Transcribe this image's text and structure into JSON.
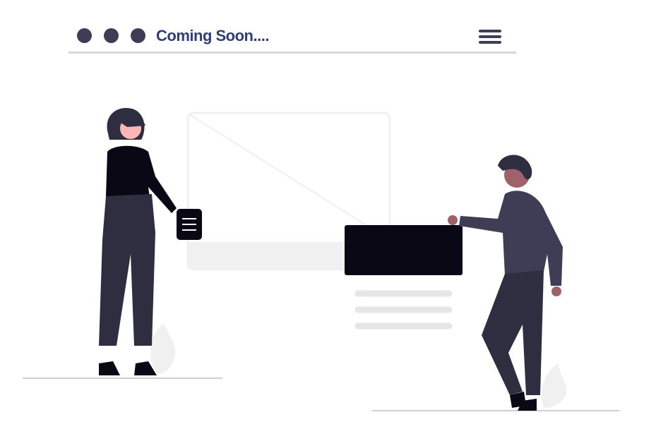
{
  "header": {
    "title": "Coming Soon....",
    "menu_icon": "hamburger-menu-icon",
    "window_dots": 3
  },
  "colors": {
    "title": "#2f3e79",
    "dark": "#3f3d56",
    "black": "#090814",
    "skin": "#a0616a",
    "placeholder": "#f2f2f2",
    "line": "#e6e6e6"
  }
}
